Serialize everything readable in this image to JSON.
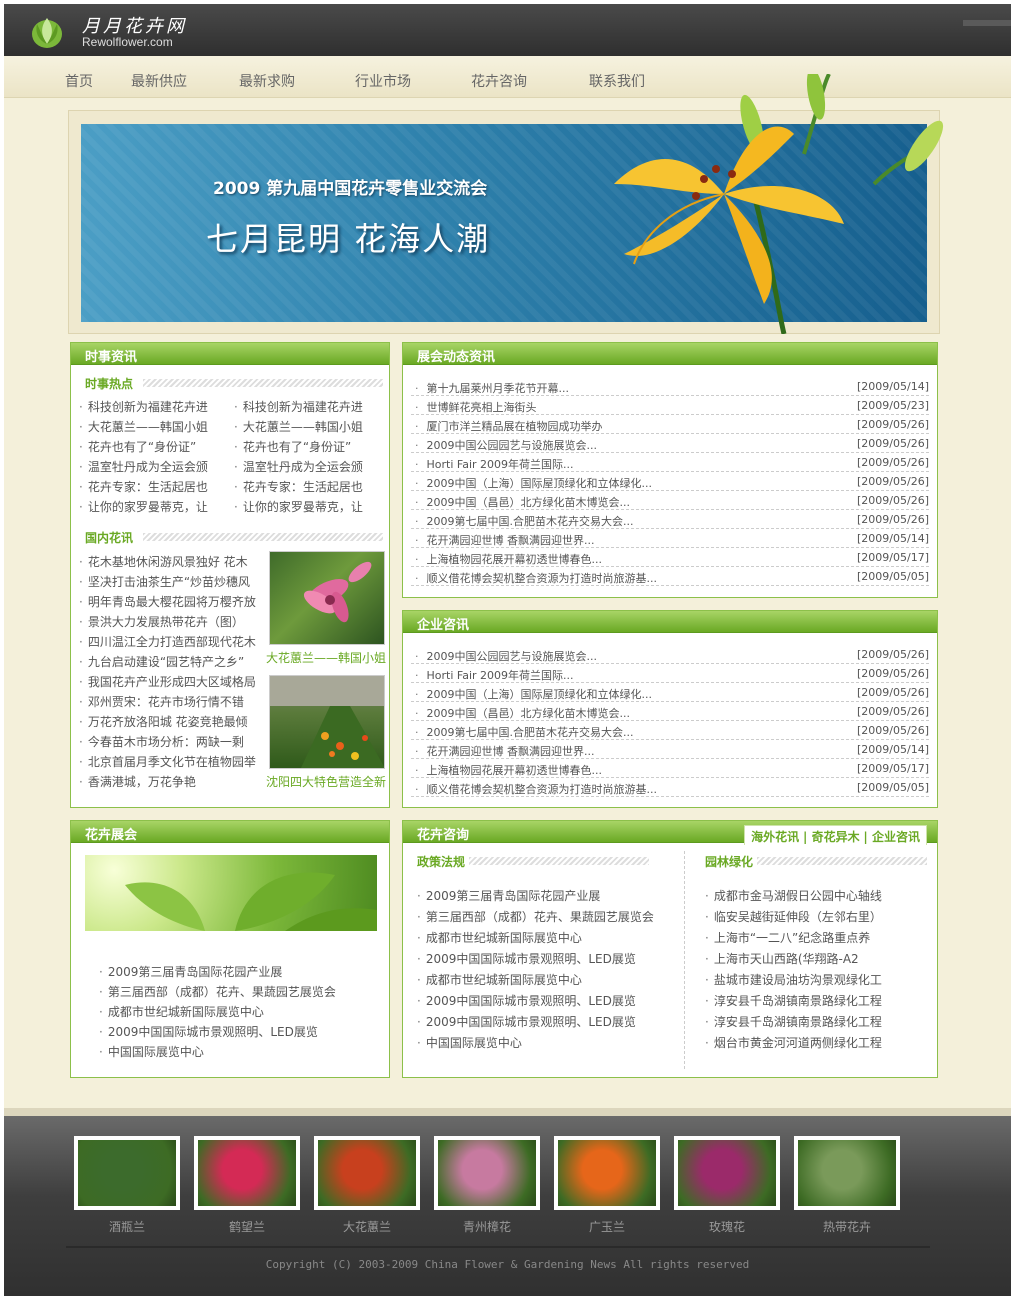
{
  "site": {
    "name_cn": "月月花卉网",
    "name_en": "Rewolflower.com"
  },
  "nav": [
    "首页",
    "最新供应",
    "最新求购",
    "行业市场",
    "花卉咨询",
    "联系我们"
  ],
  "banner": {
    "subtitle": "2009 第九届中国花卉零售业交流会",
    "title": "七月昆明  花海人潮"
  },
  "news": {
    "title": "时事资讯",
    "hot_title": "时事热点",
    "hot_left": [
      "科技创新为福建花卉进",
      "大花蕙兰——韩国小姐",
      "花卉也有了“身份证”",
      "温室牡丹成为全运会颁",
      "花卉专家：生活起居也",
      "让你的家罗曼蒂克，让"
    ],
    "hot_right": [
      "科技创新为福建花卉进",
      "大花蕙兰——韩国小姐",
      "花卉也有了“身份证”",
      "温室牡丹成为全运会颁",
      "花卉专家：生活起居也",
      "让你的家罗曼蒂克，让"
    ],
    "domestic_title": "国内花讯",
    "domestic": [
      "花木基地休闲游风景独好 花木",
      "坚决打击油茶生产“炒苗炒穗风",
      "明年青岛最大樱花园将万樱齐放",
      "景洪大力发展热带花卉（图）",
      "四川温江全力打造西部现代花木",
      "九台启动建设“园艺特产之乡”",
      "我国花卉产业形成四大区域格局",
      "邓州贾宋：花卉市场行情不错",
      "万花齐放洛阳城 花姿竞艳最倾",
      "今春苗木市场分析：两缺一剩",
      "北京首届月季文化节在植物园举",
      "香满港城，万花争艳"
    ],
    "photo1_caption": "大花蕙兰——韩国小姐",
    "photo2_caption": "沈阳四大特色营造全新"
  },
  "expo_news": {
    "title": "展会动态资讯",
    "rows": [
      {
        "t": "第十九届莱州月季花节开幕...",
        "d": "[2009/05/14]"
      },
      {
        "t": "世博鲜花亮相上海街头",
        "d": "[2009/05/23]"
      },
      {
        "t": "厦门市洋兰精品展在植物园成功举办",
        "d": "[2009/05/26]"
      },
      {
        "t": "2009中国公园园艺与设施展览会...",
        "d": "[2009/05/26]"
      },
      {
        "t": "Horti Fair 2009年荷兰国际...",
        "d": "[2009/05/26]"
      },
      {
        "t": "2009中国（上海）国际屋顶绿化和立体绿化...",
        "d": "[2009/05/26]"
      },
      {
        "t": "2009中国（昌邑）北方绿化苗木博览会...",
        "d": "[2009/05/26]"
      },
      {
        "t": "2009第七届中国.合肥苗木花卉交易大会...",
        "d": "[2009/05/26]"
      },
      {
        "t": "花开满园迎世博 香飘满园迎世界...",
        "d": "[2009/05/14]"
      },
      {
        "t": "上海植物园花展开幕初透世博春色...",
        "d": "[2009/05/17]"
      },
      {
        "t": "顺义借花博会契机整合资源为打造时尚旅游基...",
        "d": "[2009/05/05]"
      }
    ]
  },
  "corp_news": {
    "title": "企业咨讯",
    "rows": [
      {
        "t": "2009中国公园园艺与设施展览会...",
        "d": "[2009/05/26]"
      },
      {
        "t": "Horti Fair 2009年荷兰国际...",
        "d": "[2009/05/26]"
      },
      {
        "t": "2009中国（上海）国际屋顶绿化和立体绿化...",
        "d": "[2009/05/26]"
      },
      {
        "t": "2009中国（昌邑）北方绿化苗木博览会...",
        "d": "[2009/05/26]"
      },
      {
        "t": "2009第七届中国.合肥苗木花卉交易大会...",
        "d": "[2009/05/26]"
      },
      {
        "t": "花开满园迎世博 香飘满园迎世界...",
        "d": "[2009/05/14]"
      },
      {
        "t": "上海植物园花展开幕初透世博春色...",
        "d": "[2009/05/17]"
      },
      {
        "t": "顺义借花博会契机整合资源为打造时尚旅游基...",
        "d": "[2009/05/05]"
      }
    ]
  },
  "flower_expo": {
    "title": "花卉展会",
    "items": [
      "2009第三届青岛国际花园产业展",
      "第三届西部（成都）花卉、果蔬园艺展览会",
      "成都市世纪城新国际展览中心",
      "2009中国国际城市景观照明、LED展览",
      "中国国际展览中心"
    ]
  },
  "consult": {
    "title": "花卉咨询",
    "tabs": [
      "海外花讯",
      "奇花异木",
      "企业咨讯"
    ],
    "left_title": "政策法规",
    "left": [
      "2009第三届青岛国际花园产业展",
      "第三届西部（成都）花卉、果蔬园艺展览会",
      "成都市世纪城新国际展览中心",
      "2009中国国际城市景观照明、LED展览",
      "成都市世纪城新国际展览中心",
      "2009中国国际城市景观照明、LED展览",
      "2009中国国际城市景观照明、LED展览",
      "中国国际展览中心"
    ],
    "right_title": "园林绿化",
    "right": [
      "成都市金马湖假日公园中心轴线",
      "临安吴越街延伸段（左邻右里）",
      "上海市“一二八”纪念路重点养",
      "上海市天山西路(华翔路-A2",
      "盐城市建设局油坊沟景观绿化工",
      "淳安县千岛湖镇南景路绿化工程",
      "淳安县千岛湖镇南景路绿化工程",
      "烟台市黄金河河道两侧绿化工程"
    ]
  },
  "gallery": [
    {
      "label": "酒瓶兰",
      "color": "#3c6b2c"
    },
    {
      "label": "鹤望兰",
      "color": "#d42a55"
    },
    {
      "label": "大花蕙兰",
      "color": "#c8401e"
    },
    {
      "label": "青州樟花",
      "color": "#c77aa0"
    },
    {
      "label": "广玉兰",
      "color": "#e6661a"
    },
    {
      "label": "玫瑰花",
      "color": "#9b2a6a"
    },
    {
      "label": "热带花卉",
      "color": "#7a9a5a"
    }
  ],
  "copyright": "Copyright (C) 2003-2009 China Flower & Gardening News All rights reserved"
}
